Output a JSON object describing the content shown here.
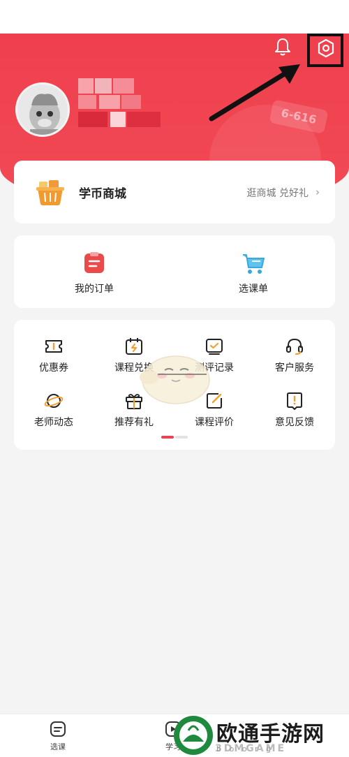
{
  "colors": {
    "brand_red": "#ee3d4c",
    "accent_orange": "#f0a033"
  },
  "header": {
    "bell_icon": "bell-icon",
    "settings_icon": "gear-icon",
    "deco_tag_text": "6-616"
  },
  "mall": {
    "title": "学币商城",
    "link_text": "逛商城 兑好礼",
    "chevron": "›"
  },
  "orders": {
    "items": [
      {
        "label": "我的订单",
        "icon": "order-list-icon"
      },
      {
        "label": "选课单",
        "icon": "shopping-cart-icon"
      }
    ]
  },
  "services": {
    "items": [
      {
        "label": "优惠券",
        "icon": "coupon-icon"
      },
      {
        "label": "课程兑换",
        "icon": "exchange-icon"
      },
      {
        "label": "测评记录",
        "icon": "assessment-icon"
      },
      {
        "label": "客户服务",
        "icon": "headset-icon"
      },
      {
        "label": "老师动态",
        "icon": "planet-icon"
      },
      {
        "label": "推荐有礼",
        "icon": "gift-icon"
      },
      {
        "label": "课程评价",
        "icon": "review-icon"
      },
      {
        "label": "意见反馈",
        "icon": "feedback-icon"
      }
    ]
  },
  "tabbar": {
    "tabs": [
      {
        "label": "选课",
        "icon": "course-icon"
      },
      {
        "label": "学习",
        "icon": "study-icon"
      }
    ]
  },
  "watermark": {
    "text": "欧通手游网",
    "sub": "3DMGAME",
    "url_text": "b o o r g"
  }
}
